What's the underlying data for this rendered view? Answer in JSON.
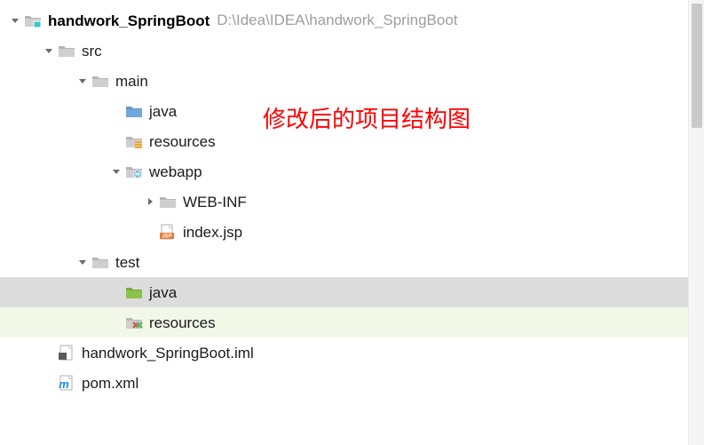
{
  "annotation": "修改后的项目结构图",
  "tree": [
    {
      "id": "root",
      "depth": 0,
      "arrow": "down",
      "icon": "module",
      "label": "handwork_SpringBoot",
      "bold": true,
      "hint": "D:\\Idea\\IDEA\\handwork_SpringBoot"
    },
    {
      "id": "src",
      "depth": 1,
      "arrow": "down",
      "icon": "folder",
      "label": "src"
    },
    {
      "id": "main",
      "depth": 2,
      "arrow": "down",
      "icon": "folder",
      "label": "main"
    },
    {
      "id": "main-java",
      "depth": 3,
      "arrow": "none",
      "icon": "src-folder",
      "label": "java"
    },
    {
      "id": "main-res",
      "depth": 3,
      "arrow": "none",
      "icon": "res-folder",
      "label": "resources"
    },
    {
      "id": "webapp",
      "depth": 3,
      "arrow": "down",
      "icon": "web-folder",
      "label": "webapp"
    },
    {
      "id": "webinf",
      "depth": 4,
      "arrow": "right",
      "icon": "folder",
      "label": "WEB-INF"
    },
    {
      "id": "indexjsp",
      "depth": 4,
      "arrow": "none",
      "icon": "jsp-file",
      "label": "index.jsp"
    },
    {
      "id": "test",
      "depth": 2,
      "arrow": "down",
      "icon": "folder",
      "label": "test"
    },
    {
      "id": "test-java",
      "depth": 3,
      "arrow": "none",
      "icon": "test-folder",
      "label": "java",
      "rowClass": "sel-gray"
    },
    {
      "id": "test-res",
      "depth": 3,
      "arrow": "none",
      "icon": "testres-folder",
      "label": "resources",
      "rowClass": "sel-green"
    },
    {
      "id": "iml",
      "depth": 1,
      "arrow": "none",
      "icon": "iml-file",
      "label": "handwork_SpringBoot.iml"
    },
    {
      "id": "pom",
      "depth": 1,
      "arrow": "none",
      "icon": "maven-file",
      "label": "pom.xml"
    }
  ],
  "icons": {
    "module": "folder-module",
    "folder": "folder-gray",
    "src-folder": "folder-blue",
    "res-folder": "folder-resources",
    "web-folder": "folder-web",
    "test-folder": "folder-green",
    "testres-folder": "folder-testres",
    "jsp-file": "file-jsp",
    "iml-file": "file-iml",
    "maven-file": "file-maven"
  }
}
